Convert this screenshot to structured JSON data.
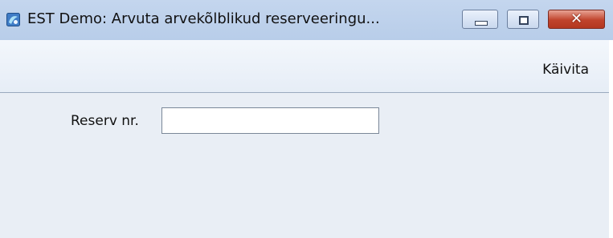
{
  "window": {
    "title": "EST Demo: Arvuta arvekõlblikud reserveeringu...",
    "app_icon": "app-logo-icon",
    "controls": {
      "minimize_icon": "minimize-icon",
      "maximize_icon": "maximize-icon",
      "close_icon": "close-icon",
      "close_glyph": "✕"
    }
  },
  "toolbar": {
    "run_label": "Käivita"
  },
  "form": {
    "reserve_label": "Reserv nr.",
    "reserve_value": "",
    "reserve_placeholder": ""
  },
  "colors": {
    "titlebar": "#c4d6ee",
    "close_button": "#c0432c",
    "background": "#e9eef5"
  }
}
